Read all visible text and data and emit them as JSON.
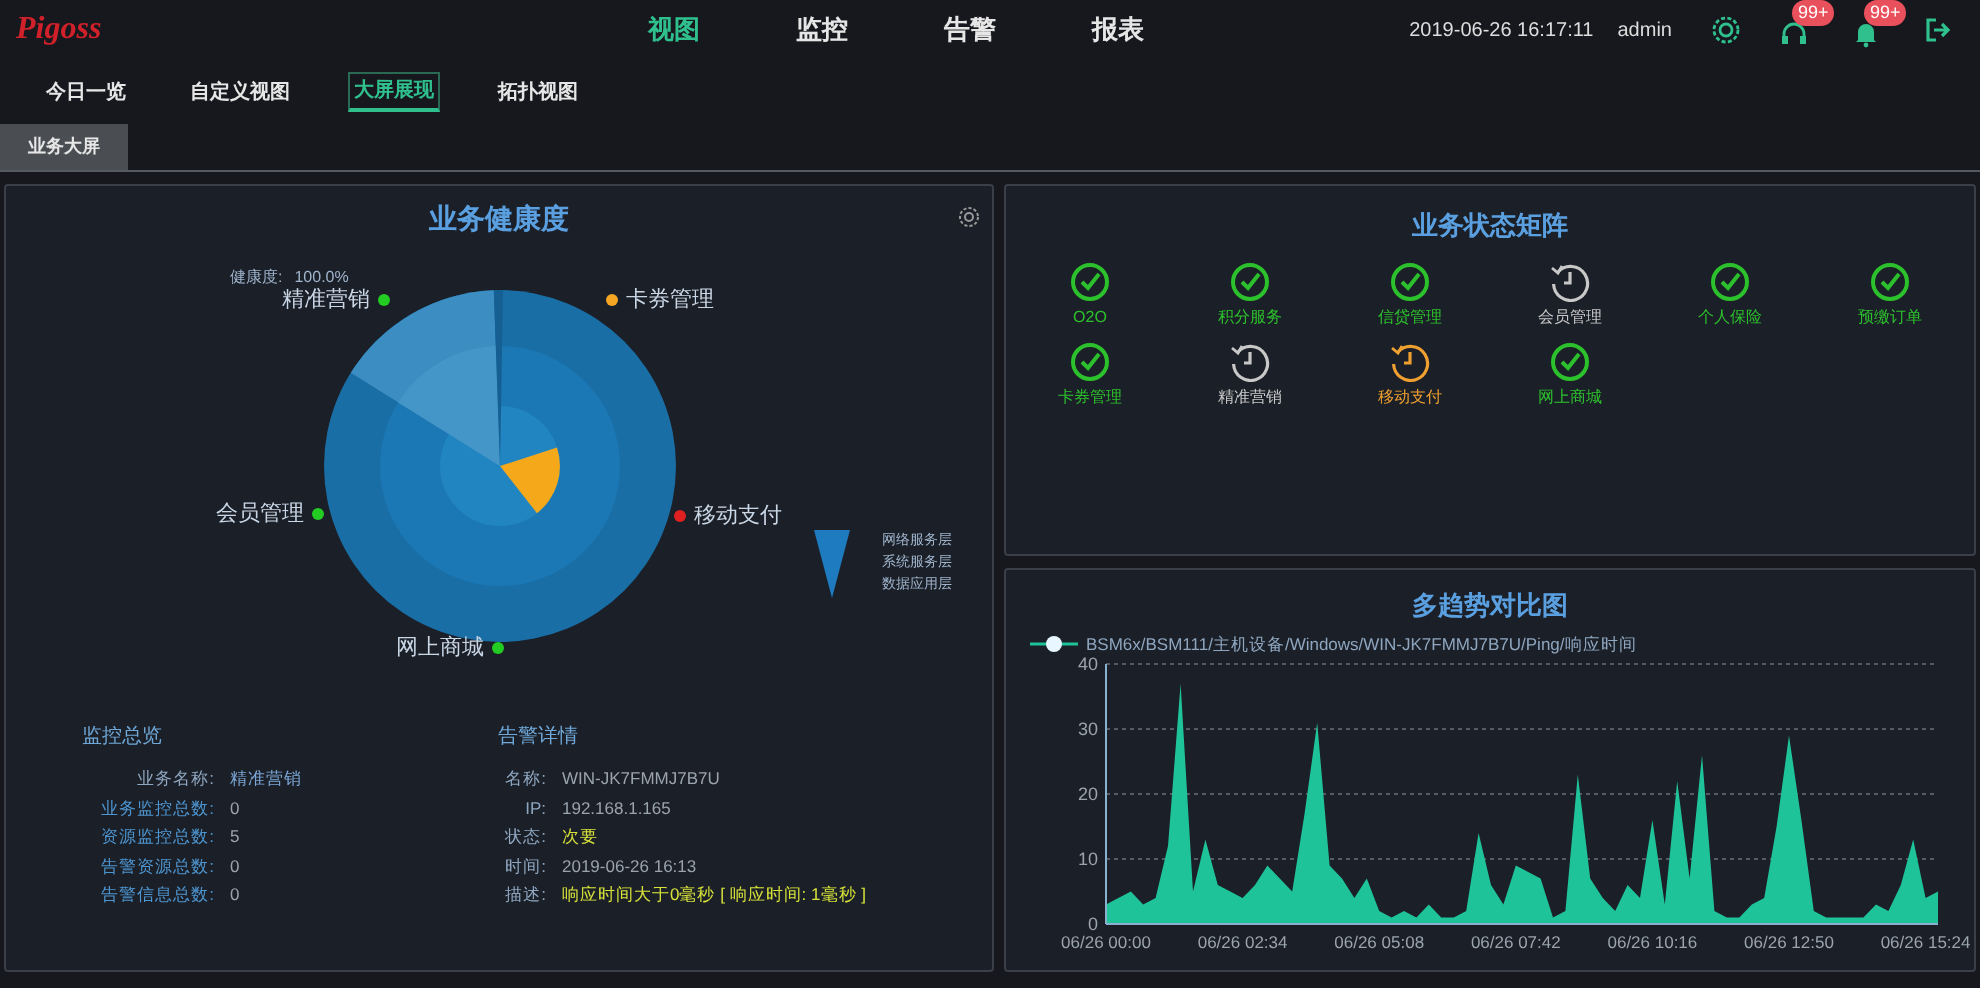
{
  "header": {
    "logo": "Pigoss",
    "nav": [
      {
        "label": "视图",
        "selected": true
      },
      {
        "label": "监控",
        "selected": false
      },
      {
        "label": "告警",
        "selected": false
      },
      {
        "label": "报表",
        "selected": false
      }
    ],
    "datetime": "2019-06-26 16:17:11",
    "user": "admin",
    "badges": [
      {
        "kind": "headset",
        "count": "99+"
      },
      {
        "kind": "bell",
        "count": "99+"
      }
    ]
  },
  "subnav": [
    {
      "label": "今日一览",
      "selected": false
    },
    {
      "label": "自定义视图",
      "selected": false
    },
    {
      "label": "大屏展现",
      "selected": true
    },
    {
      "label": "拓扑视图",
      "selected": false
    }
  ],
  "tabs": [
    {
      "label": "业务大屏",
      "selected": true
    }
  ],
  "health_panel": {
    "title": "业务健康度",
    "health_label": "健康度:",
    "health_value": "100.0%",
    "segments": [
      {
        "label": "精准营销",
        "color": "#22cc22"
      },
      {
        "label": "卡券管理",
        "color": "#f5a623"
      },
      {
        "label": "会员管理",
        "color": "#22cc22"
      },
      {
        "label": "移动支付",
        "color": "#e02020"
      },
      {
        "label": "网上商城",
        "color": "#22cc22"
      }
    ],
    "legend": [
      "网络服务层",
      "系统服务层",
      "数据应用层"
    ],
    "overview": {
      "title": "监控总览",
      "rows": [
        {
          "label": "业务名称:",
          "value": "精准营销",
          "kind": "name"
        },
        {
          "label": "业务监控总数:",
          "value": "0",
          "kind": "count"
        },
        {
          "label": "资源监控总数:",
          "value": "5",
          "kind": "count"
        },
        {
          "label": "告警资源总数:",
          "value": "0",
          "kind": "count"
        },
        {
          "label": "告警信息总数:",
          "value": "0",
          "kind": "count"
        }
      ]
    },
    "alarm": {
      "title": "告警详情",
      "rows": [
        {
          "label": "名称:",
          "value": "WIN-JK7FMMJ7B7U",
          "kind": "plain"
        },
        {
          "label": "IP:",
          "value": "192.168.1.165",
          "kind": "plain"
        },
        {
          "label": "状态:",
          "value": "次要",
          "kind": "warn"
        },
        {
          "label": "时间:",
          "value": "2019-06-26 16:13",
          "kind": "plain"
        },
        {
          "label": "描述:",
          "value": "响应时间大于0毫秒 [ 响应时间: 1毫秒 ]",
          "kind": "warn"
        }
      ]
    }
  },
  "matrix_panel": {
    "title": "业务状态矩阵",
    "items": [
      {
        "label": "O2O",
        "kind": "ok"
      },
      {
        "label": "积分服务",
        "kind": "ok"
      },
      {
        "label": "信贷管理",
        "kind": "ok"
      },
      {
        "label": "会员管理",
        "kind": "pending"
      },
      {
        "label": "个人保险",
        "kind": "ok"
      },
      {
        "label": "预缴订单",
        "kind": "ok"
      },
      {
        "label": "卡券管理",
        "kind": "ok"
      },
      {
        "label": "精准营销",
        "kind": "pending"
      },
      {
        "label": "移动支付",
        "kind": "warning"
      },
      {
        "label": "网上商城",
        "kind": "ok"
      }
    ]
  },
  "trend_panel": {
    "title": "多趋势对比图",
    "chart_data": {
      "type": "area",
      "categories": [
        "06/26 00:00",
        null,
        null,
        null,
        null,
        null,
        null,
        null,
        null,
        null,
        null,
        "06/26 02:34",
        null,
        null,
        null,
        null,
        null,
        null,
        null,
        null,
        null,
        null,
        "06/26 05:08",
        null,
        null,
        null,
        null,
        null,
        null,
        null,
        null,
        null,
        null,
        "06/26 07:42",
        null,
        null,
        null,
        null,
        null,
        null,
        null,
        null,
        null,
        null,
        "06/26 10:16",
        null,
        null,
        null,
        null,
        null,
        null,
        null,
        null,
        null,
        null,
        "06/26 12:50",
        null,
        null,
        null,
        null,
        null,
        null,
        null,
        null,
        null,
        null,
        "06/26 15:24",
        null
      ],
      "series": [
        {
          "name": "BSM6x/BSM111/主机设备/Windows/WIN-JK7FMMJ7B7U/Ping/响应时间",
          "color": "#1fc39a",
          "values": [
            3,
            4,
            5,
            3,
            4,
            12,
            37,
            5,
            13,
            6,
            5,
            4,
            6,
            9,
            7,
            5,
            17,
            31,
            9,
            7,
            4,
            7,
            2,
            1,
            2,
            1,
            3,
            1,
            1,
            2,
            14,
            6,
            3,
            9,
            8,
            7,
            1,
            2,
            23,
            7,
            4,
            2,
            6,
            4,
            16,
            3,
            22,
            7,
            26,
            2,
            1,
            1,
            3,
            4,
            15,
            29,
            16,
            2,
            1,
            1,
            1,
            1,
            3,
            2,
            6,
            13,
            4,
            5
          ]
        }
      ],
      "ylim": [
        0,
        40
      ],
      "yticks": [
        0,
        10,
        20,
        30,
        40
      ],
      "grid": true
    }
  }
}
